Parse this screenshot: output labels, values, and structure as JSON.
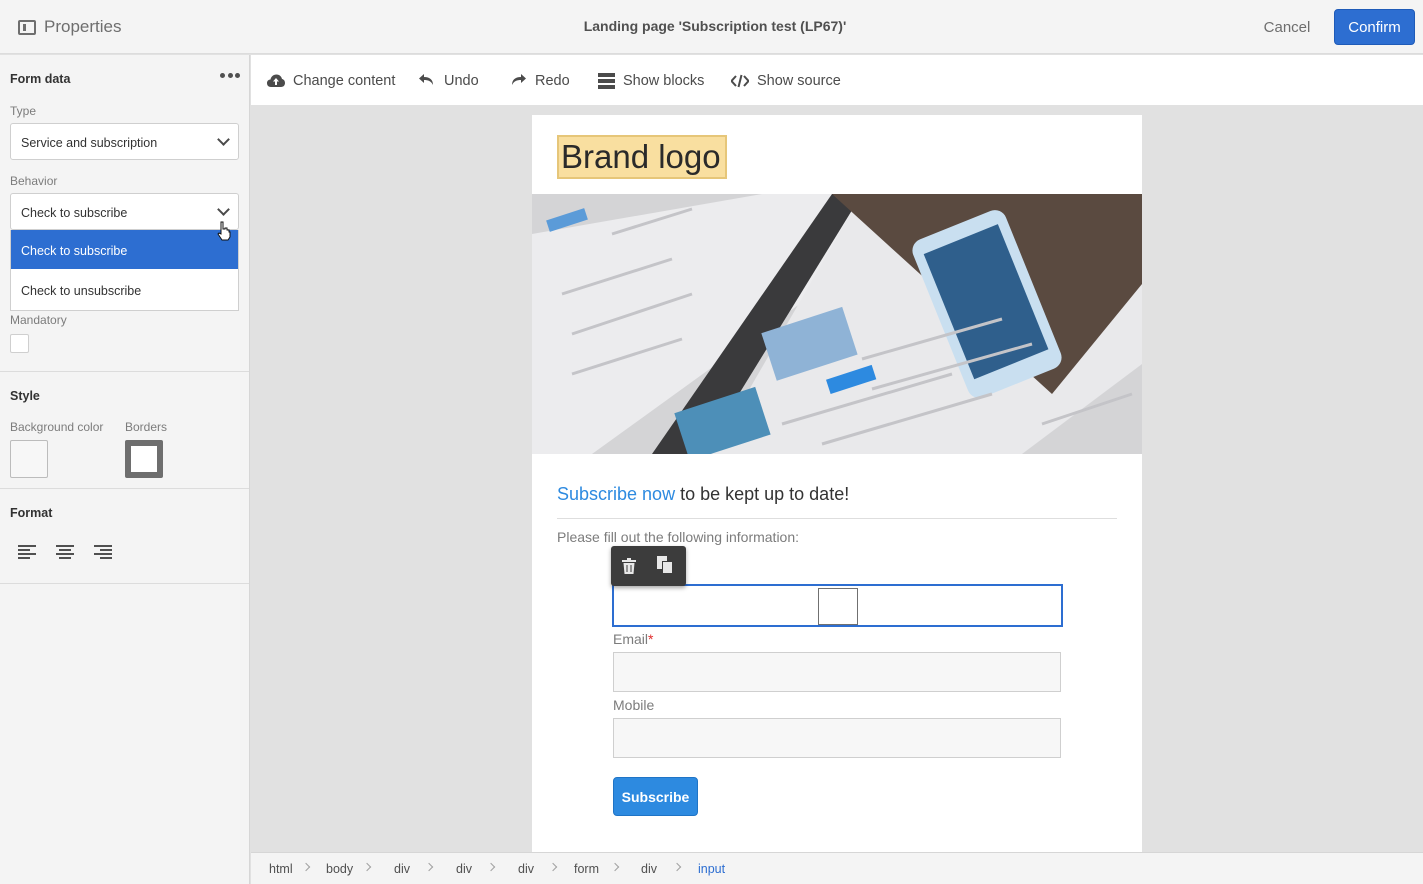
{
  "header": {
    "panel_label": "Properties",
    "title": "Landing page 'Subscription test (LP67)'",
    "cancel_label": "Cancel",
    "confirm_label": "Confirm"
  },
  "left_panel": {
    "form_data_title": "Form data",
    "type_label": "Type",
    "type_value": "Service and subscription",
    "behavior_label": "Behavior",
    "behavior_value": "Check to subscribe",
    "behavior_options": [
      "Check to subscribe",
      "Check to unsubscribe"
    ],
    "mandatory_label": "Mandatory",
    "style_title": "Style",
    "bg_color_label": "Background color",
    "borders_label": "Borders",
    "format_title": "Format"
  },
  "toolbar": {
    "change_content": "Change content",
    "undo": "Undo",
    "redo": "Redo",
    "show_blocks": "Show blocks",
    "show_source": "Show source"
  },
  "page": {
    "brand_logo": "Brand logo",
    "headline_highlight": "Subscribe now",
    "headline_rest": " to be kept up to date!",
    "intro": "Please fill out the following information:",
    "email_label": "Email",
    "required_marker": "*",
    "mobile_label": "Mobile",
    "subscribe_label": "Subscribe"
  },
  "breadcrumb": [
    "html",
    "body",
    "div",
    "div",
    "div",
    "form",
    "div",
    "input"
  ],
  "colors": {
    "accent": "#2d6ed1",
    "link": "#2d8ae0",
    "logo_bg": "#f9dfa0"
  }
}
